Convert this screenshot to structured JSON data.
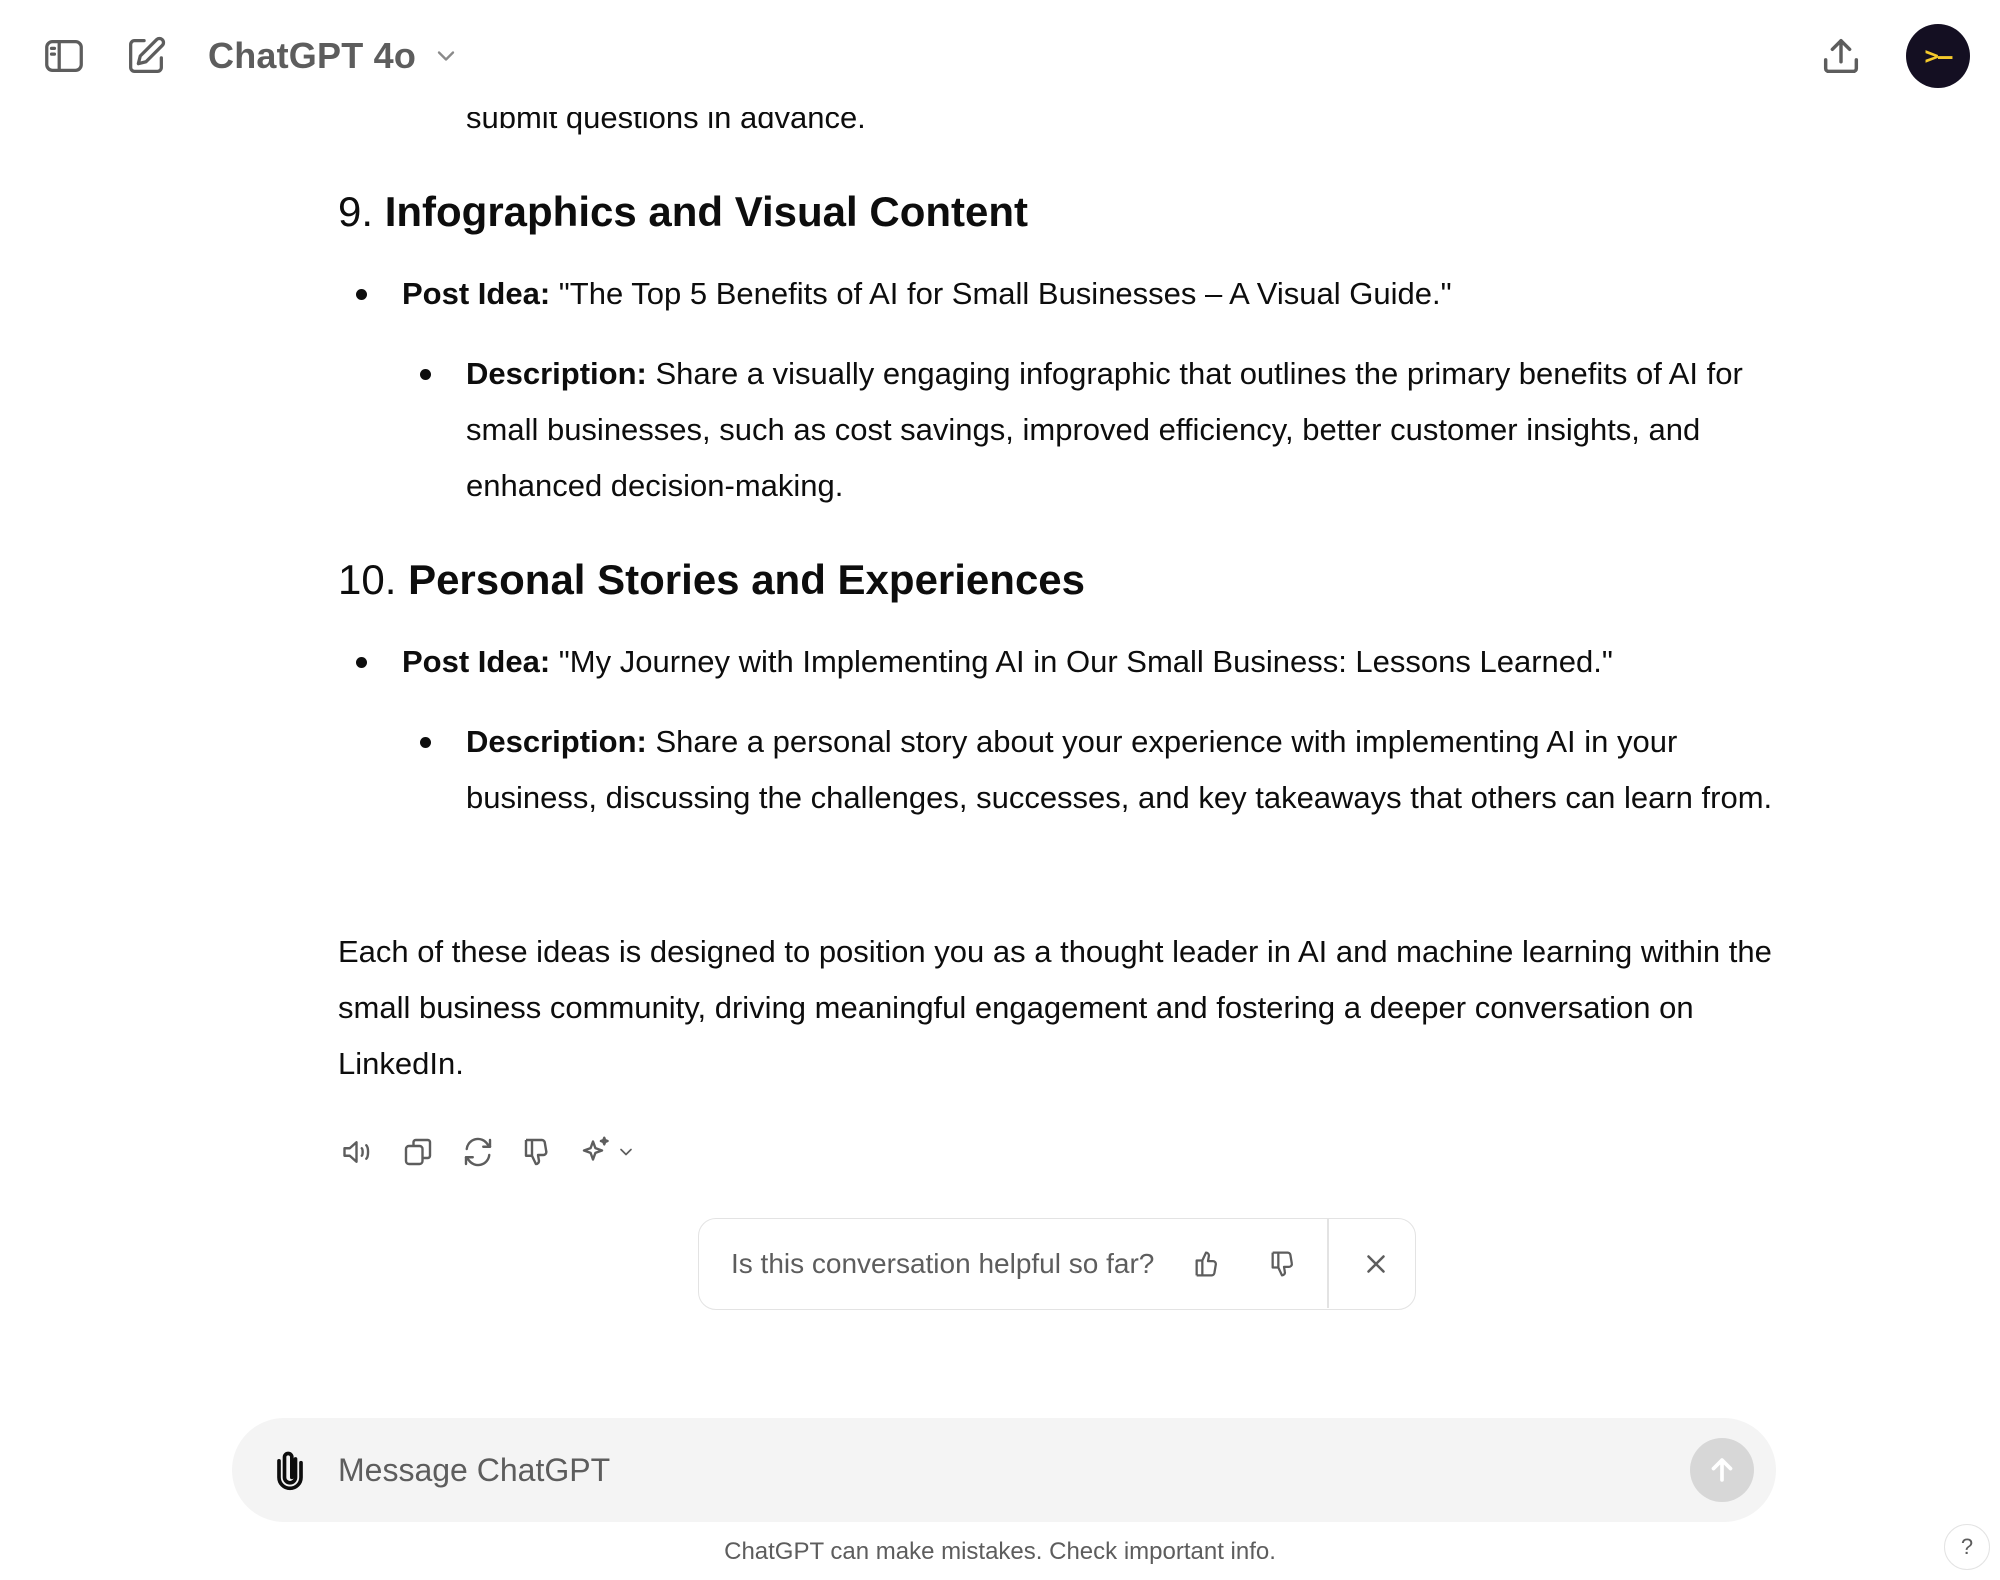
{
  "header": {
    "model_name": "ChatGPT 4o",
    "avatar_text": ">–",
    "icons": [
      "sidebar-toggle-icon",
      "new-chat-icon",
      "chevron-down-icon",
      "share-icon"
    ]
  },
  "conversation": {
    "clipped_line": "submit questions in advance.",
    "sections": [
      {
        "number": "9.",
        "title": "Infographics and Visual Content",
        "post_idea_label": "Post Idea:",
        "post_idea": " \"The Top 5 Benefits of AI for Small Businesses – A Visual Guide.\"",
        "description_label": "Description:",
        "description": " Share a visually engaging infographic that outlines the primary benefits of AI for small businesses, such as cost savings, improved efficiency, better customer insights, and enhanced decision-making."
      },
      {
        "number": "10.",
        "title": "Personal Stories and Experiences",
        "post_idea_label": "Post Idea:",
        "post_idea": " \"My Journey with Implementing AI in Our Small Business: Lessons Learned.\"",
        "description_label": "Description:",
        "description": " Share a personal story about your experience with implementing AI in your business, discussing the challenges, successes, and key takeaways that others can learn from."
      }
    ],
    "closing": "Each of these ideas is designed to position you as a thought leader in AI and machine learning within the small business community, driving meaningful engagement and fostering a deeper conversation on LinkedIn."
  },
  "message_actions": [
    "read-aloud-icon",
    "copy-icon",
    "regenerate-icon",
    "thumbs-down-icon",
    "model-switch-icon"
  ],
  "feedback": {
    "question": "Is this conversation helpful so far?"
  },
  "composer": {
    "placeholder": "Message ChatGPT"
  },
  "footer": {
    "disclaimer": "ChatGPT can make mistakes. Check important info.",
    "help": "?"
  },
  "colors": {
    "text": "#0d0d0d",
    "muted": "#5d5d5d",
    "composer_bg": "#f4f4f4",
    "avatar_bg": "#140f22",
    "avatar_fg": "#f4c92b"
  }
}
